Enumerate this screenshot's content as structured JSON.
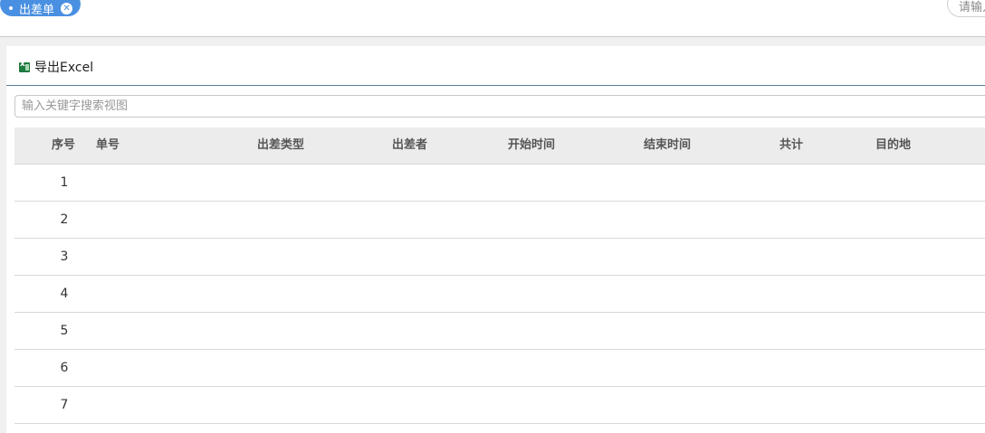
{
  "tabs": [
    {
      "label": "出差单"
    }
  ],
  "top_search": {
    "placeholder_visible": "请输入"
  },
  "toolbar": {
    "export_label": "导出Excel"
  },
  "search": {
    "placeholder": "输入关键字搜索视图"
  },
  "table": {
    "columns": [
      "序号",
      "单号",
      "出差类型",
      "出差者",
      "开始时间",
      "结束时间",
      "共计",
      "目的地"
    ],
    "rows": [
      "1",
      "2",
      "3",
      "4",
      "5",
      "6",
      "7"
    ]
  },
  "colors": {
    "tab_bg": "#4a90e2",
    "header_bg": "#ececec",
    "toolbar_rule": "#5a7a9a",
    "excel_green": "#1e7a3e"
  }
}
